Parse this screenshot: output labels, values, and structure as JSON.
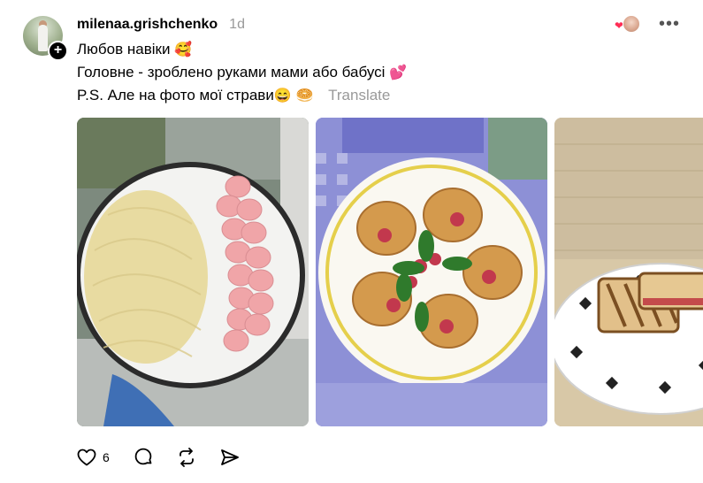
{
  "post": {
    "username": "milenaa.grishchenko",
    "timestamp": "1d",
    "follow_symbol": "+",
    "more_symbol": "•••",
    "line1": "Любов навіки",
    "line1_emoji": "🥰",
    "line2": "Головне - зроблено руками мами або бабусі",
    "line2_emoji": "💕",
    "line3": "P.S. Але на фото мої страви",
    "line3_emoji1": "😄",
    "line3_emoji2": "🥯",
    "translate": "Translate",
    "like_count": "6",
    "liker_heart": "❤"
  },
  "icons": {
    "avatar": "user-avatar",
    "follow": "plus-icon",
    "more": "more-horizontal-icon",
    "like": "heart-icon",
    "comment": "comment-icon",
    "repost": "repost-icon",
    "share": "send-icon"
  },
  "colors": {
    "text": "#000000",
    "muted": "#999999",
    "like_heart": "#ff2d55"
  }
}
